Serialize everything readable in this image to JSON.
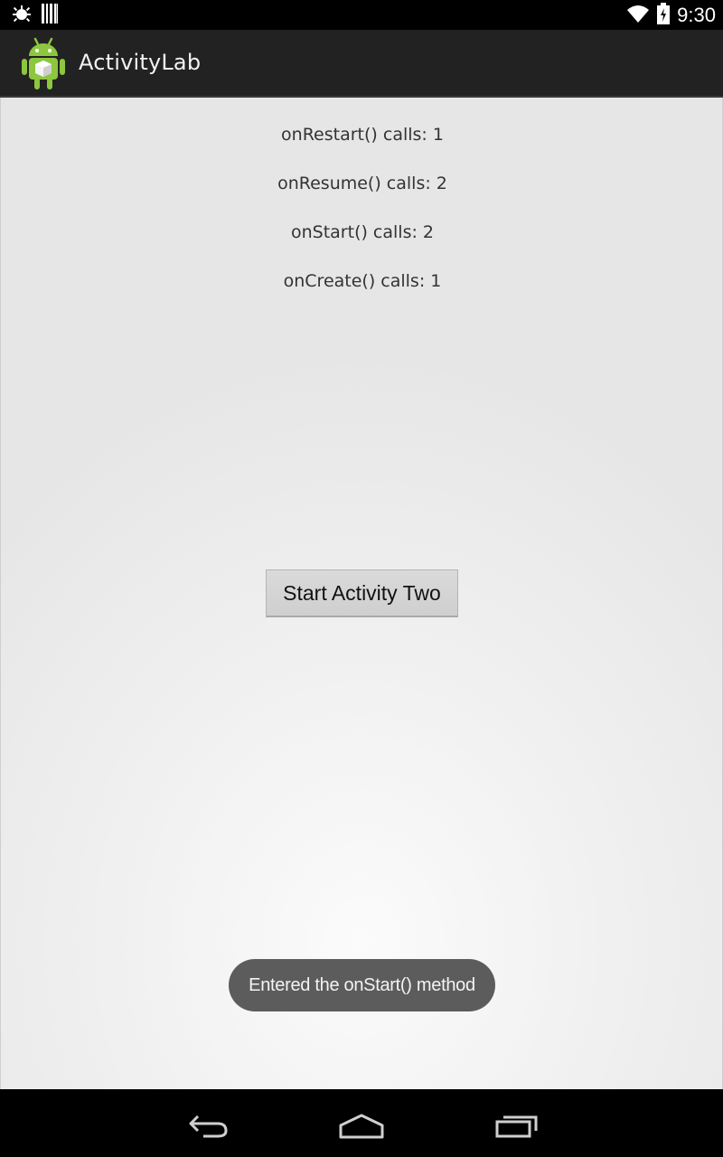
{
  "status_bar": {
    "time": "9:30",
    "left_icons": [
      "debug-icon",
      "barcode-icon"
    ],
    "right_icons": [
      "wifi-icon",
      "battery-icon"
    ]
  },
  "action_bar": {
    "title": "ActivityLab",
    "icon": "android-app-icon"
  },
  "counters": [
    {
      "label": "onRestart() calls: 1"
    },
    {
      "label": "onResume() calls: 2"
    },
    {
      "label": "onStart() calls: 2"
    },
    {
      "label": "onCreate() calls: 1"
    }
  ],
  "main_button": {
    "label": "Start Activity Two"
  },
  "toast": {
    "message": "Entered the onStart() method"
  },
  "nav_bar": {
    "buttons": [
      "back-icon",
      "home-icon",
      "recent-apps-icon"
    ]
  },
  "colors": {
    "action_bar": "#222222",
    "toast": "#5c5c5c",
    "android_green": "#8dc63f"
  }
}
